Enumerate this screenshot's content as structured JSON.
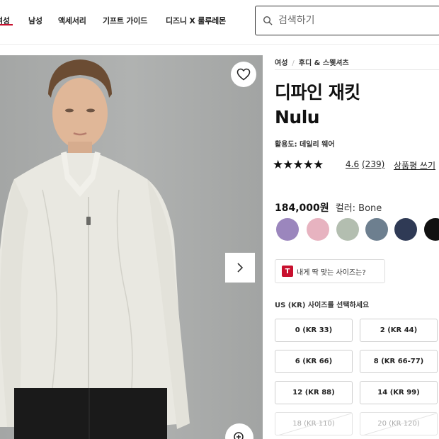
{
  "nav": {
    "items": [
      "여성",
      "남성",
      "액세서리",
      "기프트 가이드",
      "디즈니 X 룰루레몬"
    ],
    "active_index": 0
  },
  "search": {
    "placeholder": "검색하기"
  },
  "breadcrumb": [
    "여성",
    "후디 & 스웻셔츠"
  ],
  "product": {
    "title_line1": "디파인 재킷",
    "title_line2": "Nulu",
    "activity": "활용도: 데일리 웨어",
    "rating": "4.6",
    "review_count": "(239)",
    "write_review": "상품평 쓰기",
    "stars": "★★★★★",
    "price": "184,000원",
    "color_label": "컬러: Bone",
    "fit_badge": "T",
    "fit_finder": "내게 딱 맞는 사이즈는?"
  },
  "swatches": [
    {
      "name": "lavender",
      "color": "#9b86bd"
    },
    {
      "name": "pink",
      "color": "#e7b3c0"
    },
    {
      "name": "sage",
      "color": "#b3beb0"
    },
    {
      "name": "slate-blue",
      "color": "#6d7f8f"
    },
    {
      "name": "navy",
      "color": "#2f3a55"
    },
    {
      "name": "black",
      "color": "#111111"
    }
  ],
  "sizes": {
    "heading": "US (KR) 사이즈를 선택하세요",
    "options": [
      {
        "label": "0 (KR 33)",
        "available": true
      },
      {
        "label": "2 (KR 44)",
        "available": true
      },
      {
        "label": "6 (KR 66)",
        "available": true
      },
      {
        "label": "8 (KR 66-77)",
        "available": true
      },
      {
        "label": "12 (KR 88)",
        "available": true
      },
      {
        "label": "14 (KR 99)",
        "available": true
      },
      {
        "label": "18 (KR 110)",
        "available": false
      },
      {
        "label": "20 (KR 120)",
        "available": false
      }
    ]
  },
  "colors": {
    "accent": "#c8102e",
    "image_bg": "#a9abaa",
    "jacket": "#e9e8e1"
  }
}
